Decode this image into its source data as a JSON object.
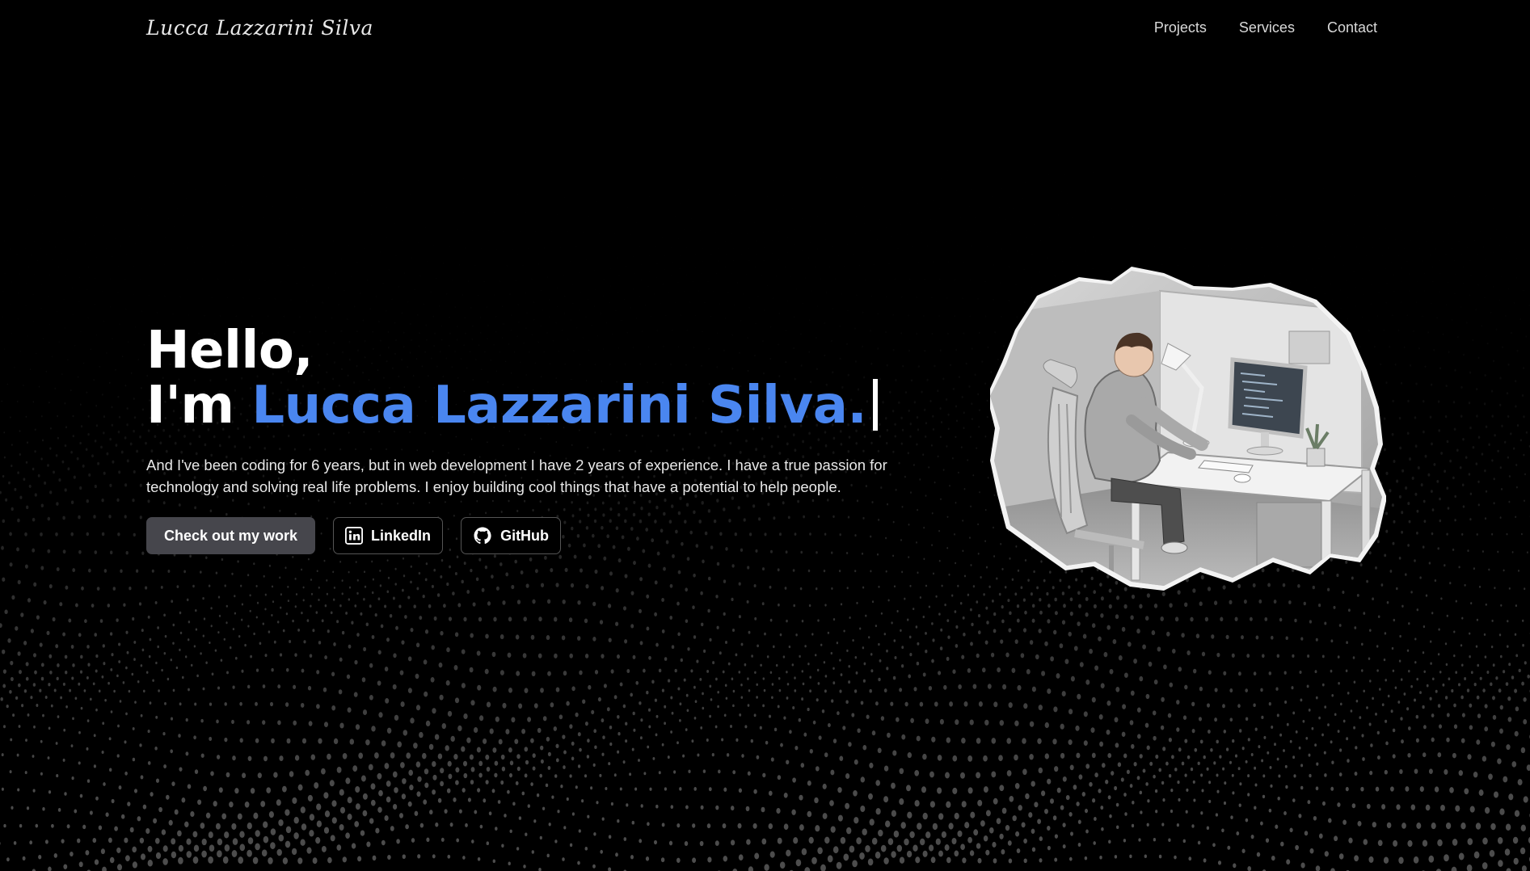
{
  "nav": {
    "logo": "Lucca Lazzarini Silva",
    "links": [
      "Projects",
      "Services",
      "Contact"
    ]
  },
  "hero": {
    "greeting": "Hello,",
    "intro_prefix": "I'm",
    "name": "Lucca Lazzarini Silva.",
    "description": "And I've been coding for 6 years, but in web development I have 2 years of experience. I have a true passion for technology and solving real life problems. I enjoy building cool things that have a potential to help people.",
    "primary_button": "Check out my work",
    "linkedin_button": "LinkedIn",
    "github_button": "GitHub"
  },
  "icons": {
    "linkedin": "linkedin-icon",
    "github": "github-icon"
  },
  "colors": {
    "background": "#000000",
    "accent": "#4a86f0",
    "primary_button": "#46464c",
    "dots": "#5a5a5a"
  }
}
